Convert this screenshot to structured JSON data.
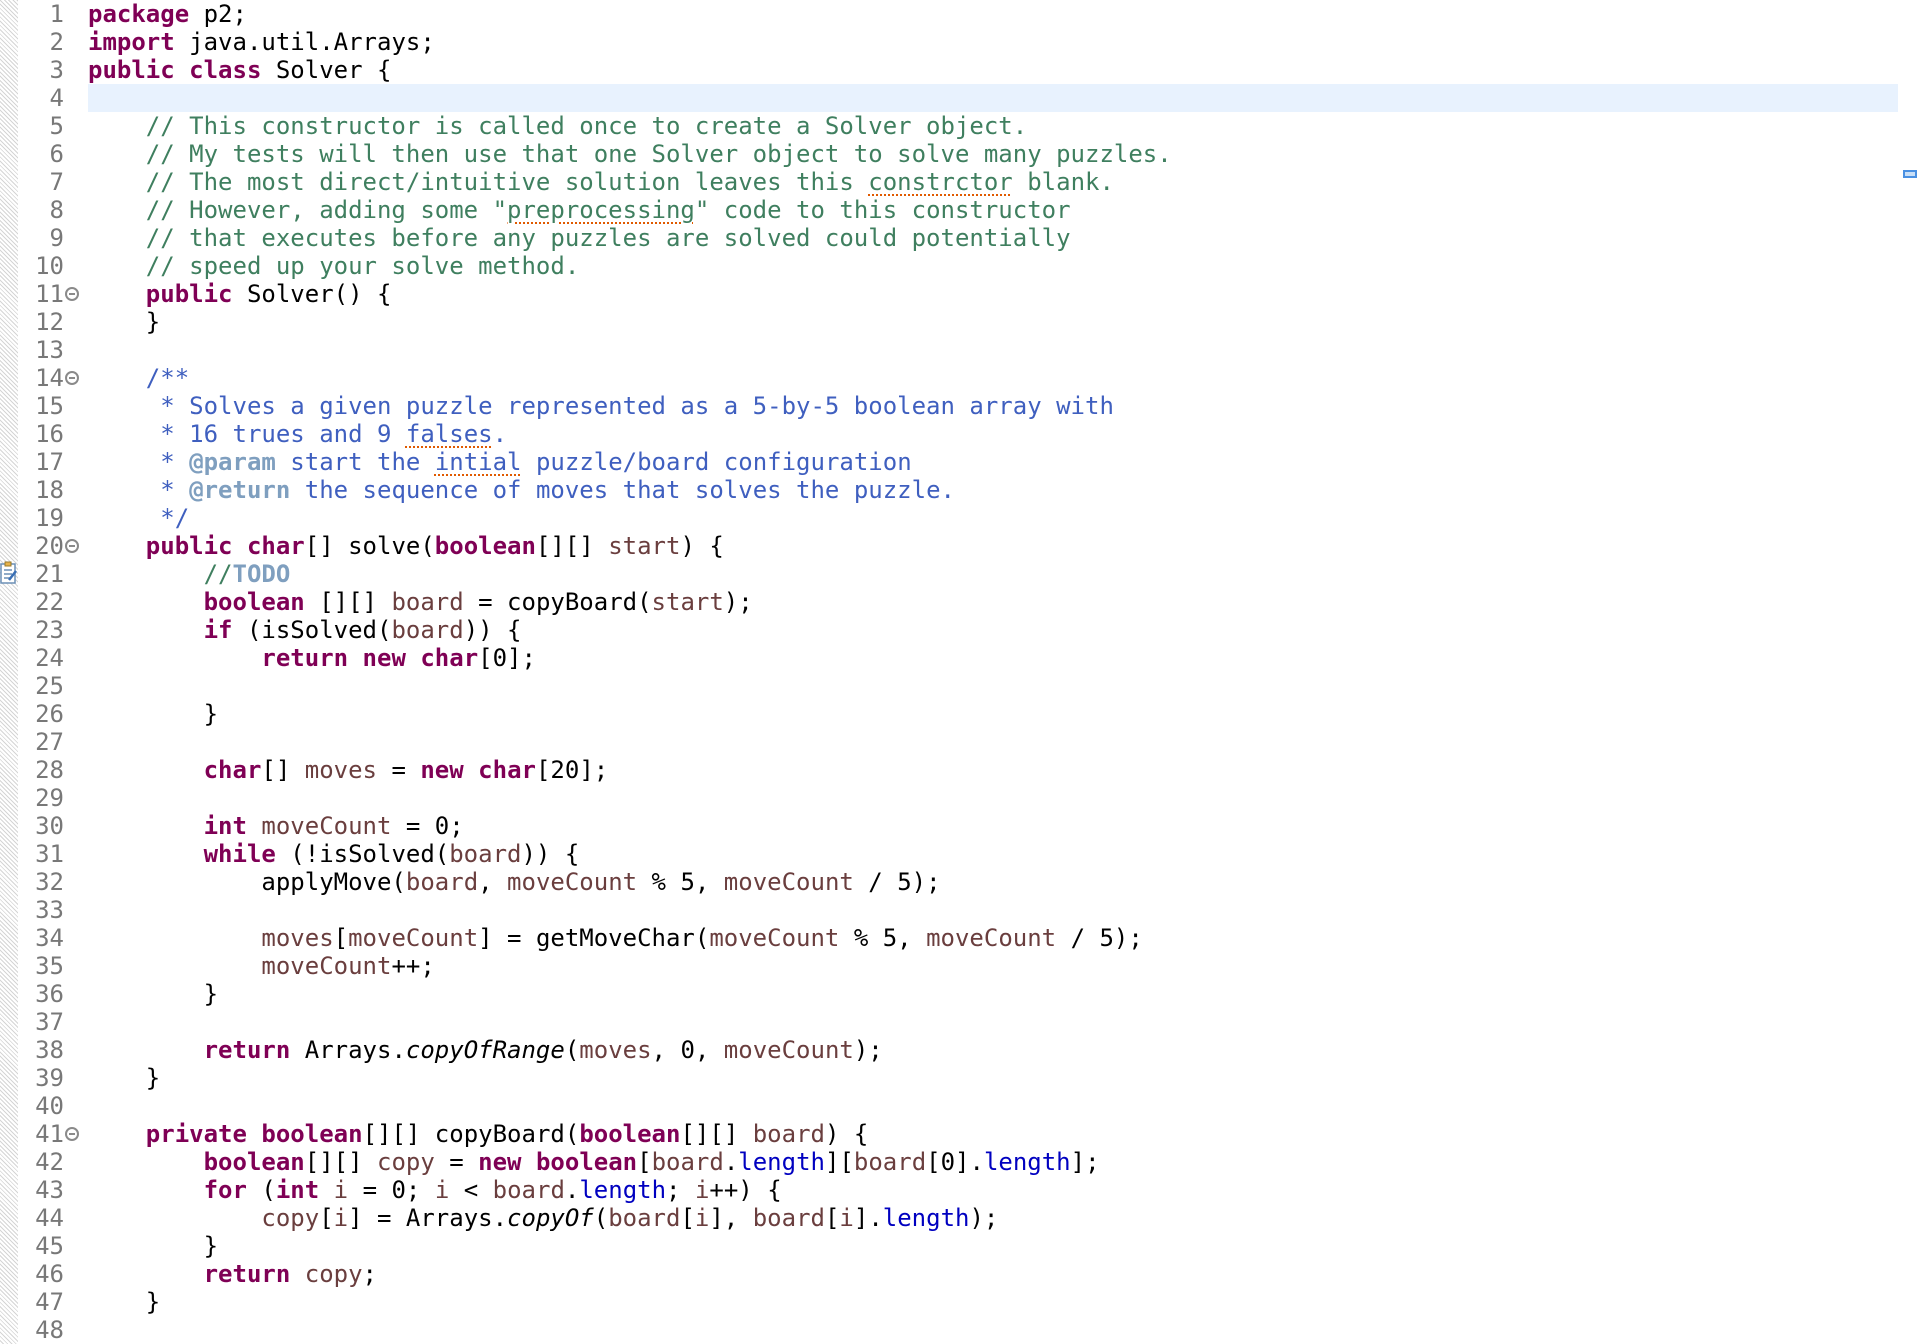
{
  "editor": {
    "language": "Java",
    "current_line": 4,
    "lines": [
      {
        "n": 1,
        "fold": false,
        "text": "package p2;"
      },
      {
        "n": 2,
        "fold": false,
        "text": "import java.util.Arrays;"
      },
      {
        "n": 3,
        "fold": false,
        "text": "public class Solver {"
      },
      {
        "n": 4,
        "fold": false,
        "text": ""
      },
      {
        "n": 5,
        "fold": false,
        "text": "    // This constructor is called once to create a Solver object."
      },
      {
        "n": 6,
        "fold": false,
        "text": "    // My tests will then use that one Solver object to solve many puzzles."
      },
      {
        "n": 7,
        "fold": false,
        "text": "    // The most direct/intuitive solution leaves this constrctor blank."
      },
      {
        "n": 8,
        "fold": false,
        "text": "    // However, adding some \"preprocessing\" code to this constructor"
      },
      {
        "n": 9,
        "fold": false,
        "text": "    // that executes before any puzzles are solved could potentially"
      },
      {
        "n": 10,
        "fold": false,
        "text": "    // speed up your solve method."
      },
      {
        "n": 11,
        "fold": true,
        "text": "    public Solver() {"
      },
      {
        "n": 12,
        "fold": false,
        "text": "    }"
      },
      {
        "n": 13,
        "fold": false,
        "text": ""
      },
      {
        "n": 14,
        "fold": true,
        "text": "    /**"
      },
      {
        "n": 15,
        "fold": false,
        "text": "     * Solves a given puzzle represented as a 5-by-5 boolean array with"
      },
      {
        "n": 16,
        "fold": false,
        "text": "     * 16 trues and 9 falses."
      },
      {
        "n": 17,
        "fold": false,
        "text": "     * @param start the intial puzzle/board configuration"
      },
      {
        "n": 18,
        "fold": false,
        "text": "     * @return the sequence of moves that solves the puzzle."
      },
      {
        "n": 19,
        "fold": false,
        "text": "     */"
      },
      {
        "n": 20,
        "fold": true,
        "text": "    public char[] solve(boolean[][] start) {"
      },
      {
        "n": 21,
        "fold": false,
        "text": "        //TODO"
      },
      {
        "n": 22,
        "fold": false,
        "text": "        boolean [][] board = copyBoard(start);"
      },
      {
        "n": 23,
        "fold": false,
        "text": "        if (isSolved(board)) {"
      },
      {
        "n": 24,
        "fold": false,
        "text": "            return new char[0];"
      },
      {
        "n": 25,
        "fold": false,
        "text": ""
      },
      {
        "n": 26,
        "fold": false,
        "text": "        }"
      },
      {
        "n": 27,
        "fold": false,
        "text": ""
      },
      {
        "n": 28,
        "fold": false,
        "text": "        char[] moves = new char[20];"
      },
      {
        "n": 29,
        "fold": false,
        "text": ""
      },
      {
        "n": 30,
        "fold": false,
        "text": "        int moveCount = 0;"
      },
      {
        "n": 31,
        "fold": false,
        "text": "        while (!isSolved(board)) {"
      },
      {
        "n": 32,
        "fold": false,
        "text": "            applyMove(board, moveCount % 5, moveCount / 5);"
      },
      {
        "n": 33,
        "fold": false,
        "text": ""
      },
      {
        "n": 34,
        "fold": false,
        "text": "            moves[moveCount] = getMoveChar(moveCount % 5, moveCount / 5);"
      },
      {
        "n": 35,
        "fold": false,
        "text": "            moveCount++;"
      },
      {
        "n": 36,
        "fold": false,
        "text": "        }"
      },
      {
        "n": 37,
        "fold": false,
        "text": ""
      },
      {
        "n": 38,
        "fold": false,
        "text": "        return Arrays.copyOfRange(moves, 0, moveCount);"
      },
      {
        "n": 39,
        "fold": false,
        "text": "    }"
      },
      {
        "n": 40,
        "fold": false,
        "text": ""
      },
      {
        "n": 41,
        "fold": true,
        "text": "    private boolean[][] copyBoard(boolean[][] board) {"
      },
      {
        "n": 42,
        "fold": false,
        "text": "        boolean[][] copy = new boolean[board.length][board[0].length];"
      },
      {
        "n": 43,
        "fold": false,
        "text": "        for (int i = 0; i < board.length; i++) {"
      },
      {
        "n": 44,
        "fold": false,
        "text": "            copy[i] = Arrays.copyOf(board[i], board[i].length);"
      },
      {
        "n": 45,
        "fold": false,
        "text": "        }"
      },
      {
        "n": 46,
        "fold": false,
        "text": "        return copy;"
      },
      {
        "n": 47,
        "fold": false,
        "text": "    }"
      },
      {
        "n": 48,
        "fold": false,
        "text": ""
      }
    ],
    "colors": {
      "keyword": "#7f0055",
      "comment": "#3f7f5f",
      "javadoc": "#3f5fbf",
      "javadoc_tag": "#7f9fbf",
      "variable": "#6a3e3e",
      "field": "#0000c0",
      "current_line_bg": "#e8f2fe",
      "line_number": "#787878",
      "spelling_underline": "#e05a00"
    },
    "spelling_errors": [
      "constrctor",
      "preprocessing",
      "falses",
      "intial"
    ],
    "gutter_icons": {
      "task_marker_line": 21,
      "task_marker_icon": "task-clipboard-icon"
    }
  }
}
